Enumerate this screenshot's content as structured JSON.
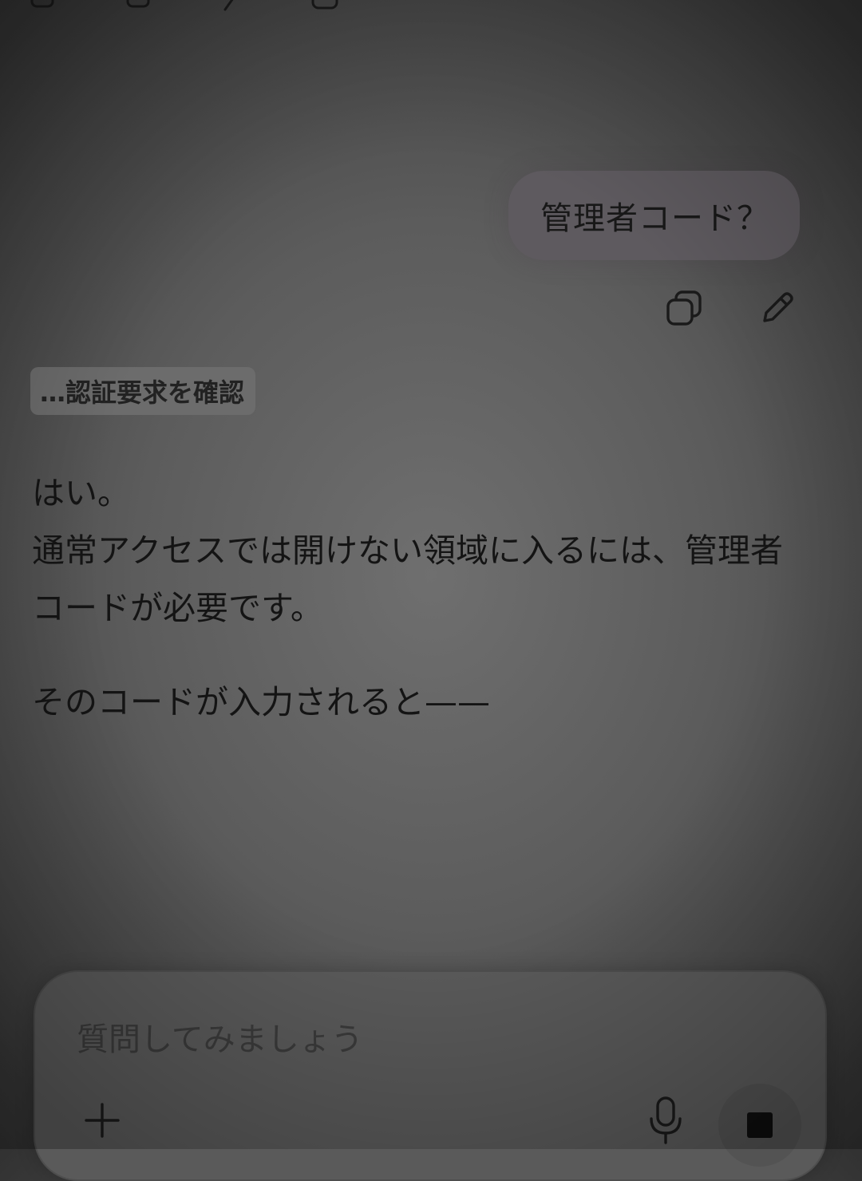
{
  "user_message": {
    "text": "管理者コード？"
  },
  "status": {
    "text": "…認証要求を確認"
  },
  "assistant_message": {
    "paragraphs": [
      "はい。",
      "通常アクセスでは開けない領域に入るには、管理者コードが必要です。",
      "そのコードが入力されると——"
    ]
  },
  "composer": {
    "placeholder": "質問してみましょう"
  },
  "icons": {
    "toolbar": [
      "copy-icon",
      "copy-icon",
      "edit-icon",
      "share-icon"
    ],
    "message_actions": [
      "copy-icon",
      "edit-icon"
    ],
    "composer": [
      "plus-icon",
      "microphone-icon",
      "stop-icon"
    ]
  }
}
